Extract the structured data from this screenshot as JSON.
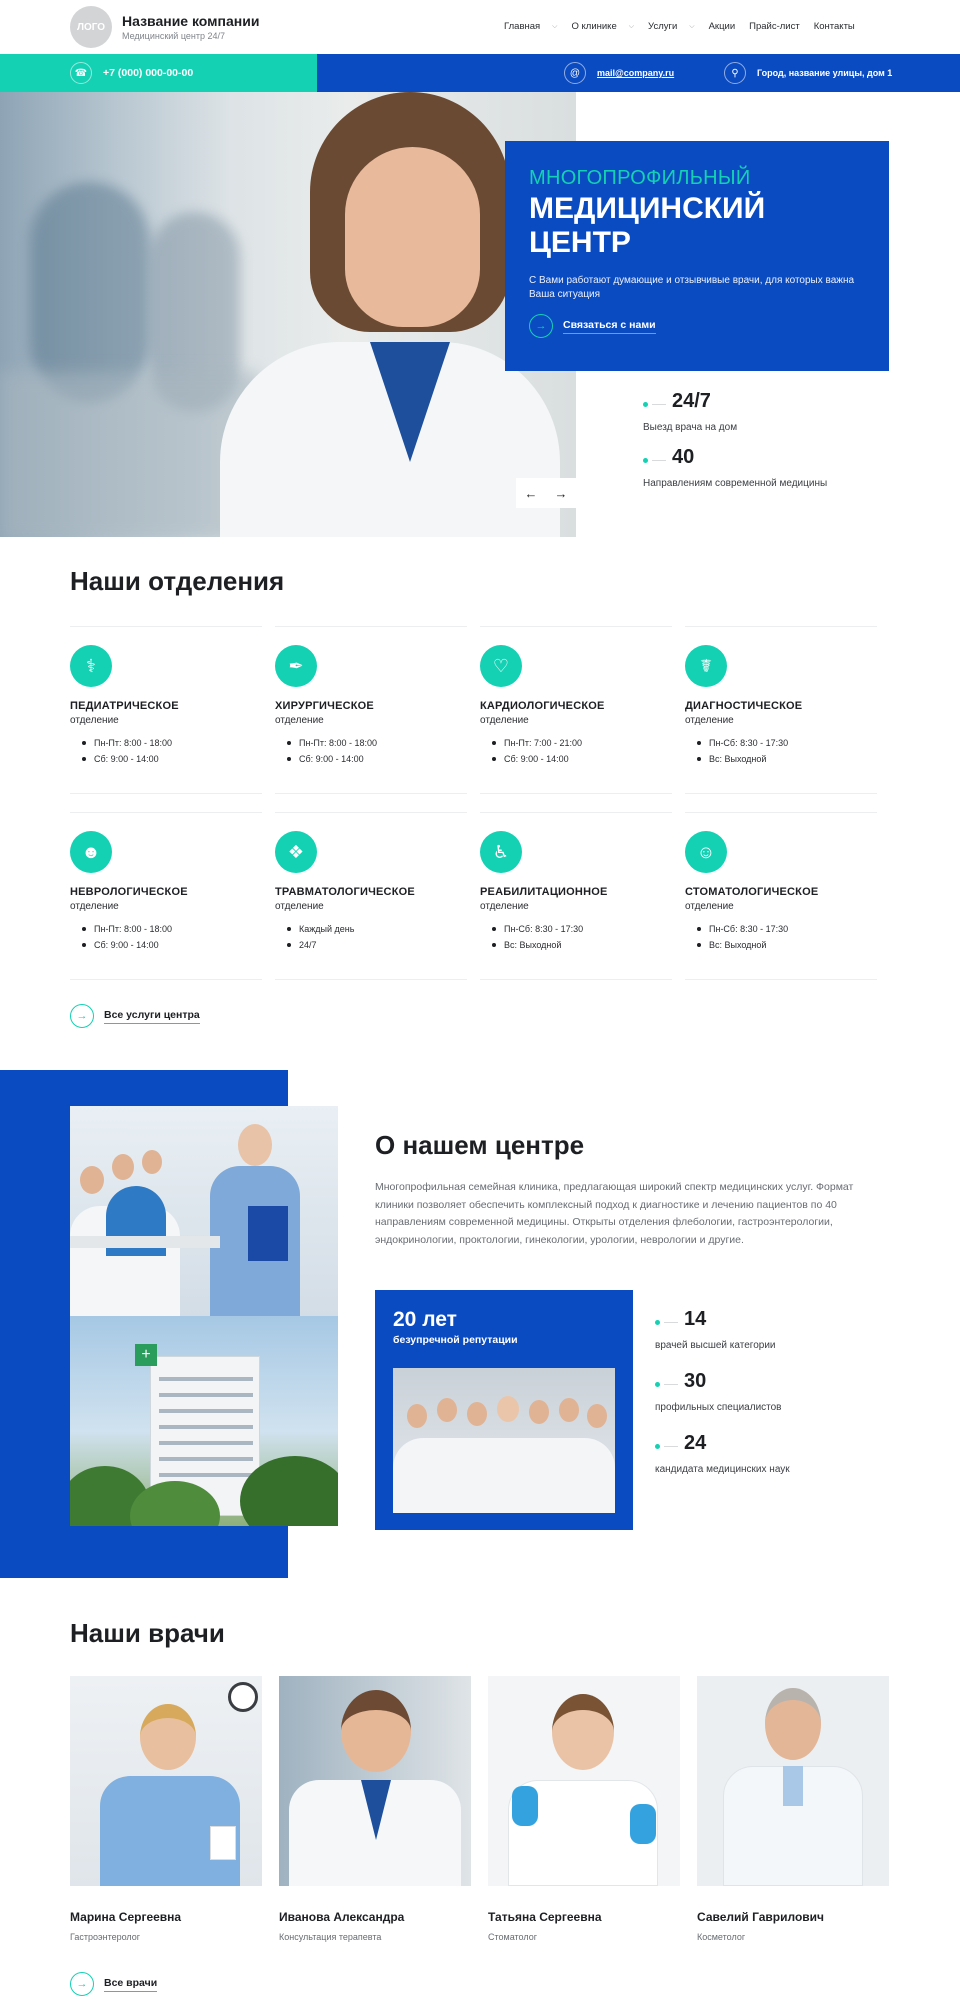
{
  "header": {
    "logo": "ЛОГО",
    "company_name": "Название компании",
    "company_sub": "Медицинский центр 24/7",
    "nav": [
      {
        "label": "Главная",
        "dropdown": true
      },
      {
        "label": "О клинике",
        "dropdown": true
      },
      {
        "label": "Услуги",
        "dropdown": true
      },
      {
        "label": "Акции",
        "dropdown": false
      },
      {
        "label": "Прайс-лист",
        "dropdown": false
      },
      {
        "label": "Контакты",
        "dropdown": false
      }
    ]
  },
  "contact": {
    "phone": "+7 (000) 000-00-00",
    "email": "mail@company.ru",
    "address": "Город, название улицы, дом 1"
  },
  "hero": {
    "kicker": "МНОГОПРОФИЛЬНЫЙ",
    "title_line1": "МЕДИЦИНСКИЙ",
    "title_line2": "ЦЕНТР",
    "description": "С Вами работают думающие и отзывчивые врачи, для которых важна Ваша ситуация",
    "cta": "Связаться с нами",
    "stats": [
      {
        "value": "24/7",
        "label": "Выезд врача на дом"
      },
      {
        "value": "40",
        "label": "Направлениям современной медицины"
      }
    ]
  },
  "departments": {
    "title": "Наши отделения",
    "items": [
      {
        "name": "ПЕДИАТРИЧЕСКОЕ",
        "sub": "отделение",
        "icon": "stethoscope-icon",
        "hours": [
          "Пн-Пт: 8:00 - 18:00",
          "Сб: 9:00 - 14:00"
        ]
      },
      {
        "name": "ХИРУРГИЧЕСКОЕ",
        "sub": "отделение",
        "icon": "scalpel-icon",
        "hours": [
          "Пн-Пт: 8:00 - 18:00",
          "Сб: 9:00 - 14:00"
        ]
      },
      {
        "name": "КАРДИОЛОГИЧЕСКОЕ",
        "sub": "отделение",
        "icon": "heart-pulse-icon",
        "hours": [
          "Пн-Пт: 7:00 - 21:00",
          "Сб: 9:00 - 14:00"
        ]
      },
      {
        "name": "ДИАГНОСТИЧЕСКОЕ",
        "sub": "отделение",
        "icon": "medical-symbol-icon",
        "hours": [
          "Пн-Сб: 8:30 - 17:30",
          "Вс: Выходной"
        ]
      },
      {
        "name": "НЕВРОЛОГИЧЕСКОЕ",
        "sub": "отделение",
        "icon": "doctor-icon",
        "hours": [
          "Пн-Пт: 8:00 - 18:00",
          "Сб: 9:00 - 14:00"
        ]
      },
      {
        "name": "ТРАВМАТОЛОГИЧЕСКОЕ",
        "sub": "отделение",
        "icon": "bone-icon",
        "hours": [
          "Каждый день",
          "24/7"
        ]
      },
      {
        "name": "РЕАБИЛИТАЦИОННОЕ",
        "sub": "отделение",
        "icon": "wheelchair-icon",
        "hours": [
          "Пн-Сб: 8:30 - 17:30",
          "Вс: Выходной"
        ]
      },
      {
        "name": "СТОМАТОЛОГИЧЕСКОЕ",
        "sub": "отделение",
        "icon": "tooth-icon",
        "hours": [
          "Пн-Сб: 8:30 - 17:30",
          "Вс: Выходной"
        ]
      }
    ],
    "all_link": "Все услуги центра"
  },
  "about": {
    "title": "О нашем центре",
    "text": "Многопрофильная семейная клиника, предлагающая широкий спектр медицинских услуг. Формат клиники позволяет обеспечить комплексный подход к диагностике и лечению пациентов по 40 направлениям современной медицины. Открыты отделения флебологии, гастроэнтерологии, эндокринологии, проктологии, гинекологии, урологии, неврологии и другие.",
    "reputation_value": "20 лет",
    "reputation_label": "безупречной репутации",
    "stats": [
      {
        "value": "14",
        "label": "врачей высшей категории"
      },
      {
        "value": "30",
        "label": "профильных специалистов"
      },
      {
        "value": "24",
        "label": "кандидата медицинских наук"
      }
    ]
  },
  "doctors": {
    "title": "Наши врачи",
    "items": [
      {
        "name": "Марина Сергеевна",
        "role": "Гастроэнтеролог"
      },
      {
        "name": "Иванова Александра",
        "role": "Консультация терапевта"
      },
      {
        "name": "Татьяна Сергеевна",
        "role": "Стоматолог"
      },
      {
        "name": "Савелий Гаврилович",
        "role": "Косметолог"
      }
    ],
    "all_link": "Все врачи"
  },
  "colors": {
    "accent_blue": "#0b4bc1",
    "accent_green": "#14d1b4",
    "text_dark": "#1d1f23",
    "text_muted": "#686d73"
  }
}
